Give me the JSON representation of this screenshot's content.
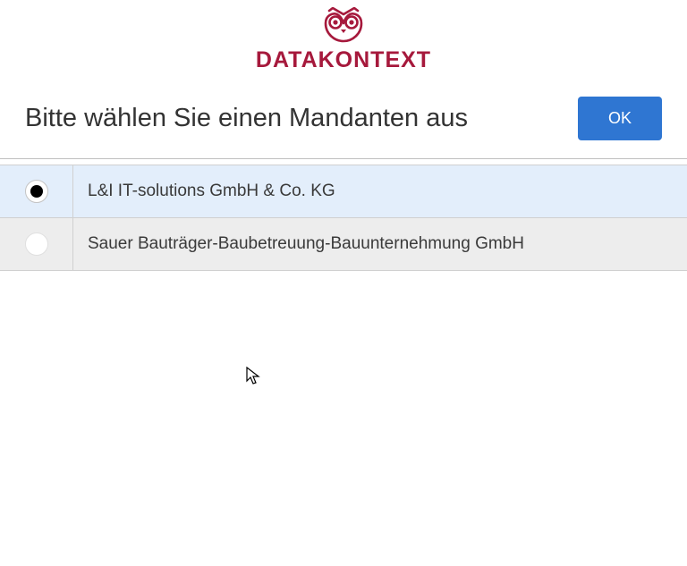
{
  "logo": {
    "brand": "DATAKONTEXT"
  },
  "title": "Bitte wählen Sie einen Mandanten aus",
  "ok_label": "OK",
  "mandants": [
    {
      "label": "L&I IT-solutions GmbH & Co. KG",
      "selected": true
    },
    {
      "label": "Sauer Bauträger-Baubetreuung-Bauunternehmung GmbH",
      "selected": false
    }
  ]
}
